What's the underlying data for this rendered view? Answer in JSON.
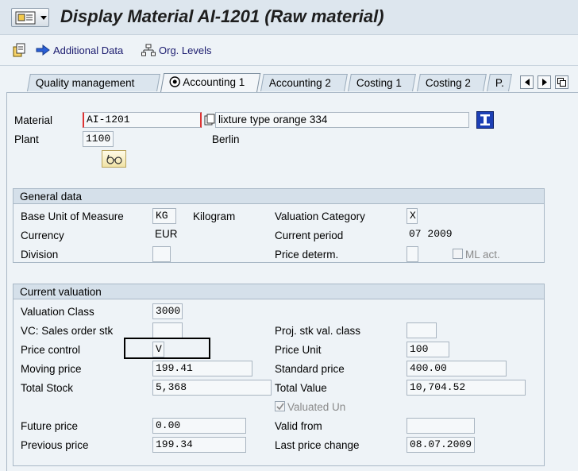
{
  "window": {
    "title": "Display Material AI-1201 (Raw material)"
  },
  "toolbar": {
    "additional_data": "Additional Data",
    "org_levels": "Org. Levels"
  },
  "tabs": [
    {
      "label": "Quality management",
      "active": false
    },
    {
      "label": "Accounting 1",
      "active": true
    },
    {
      "label": "Accounting 2",
      "active": false
    },
    {
      "label": "Costing 1",
      "active": false
    },
    {
      "label": "Costing 2",
      "active": false
    },
    {
      "label": "P.",
      "active": false
    }
  ],
  "header": {
    "material_label": "Material",
    "material_value": "AI-1201",
    "material_desc": "lixture type orange 334",
    "plant_label": "Plant",
    "plant_value": "1100",
    "plant_name": "Berlin"
  },
  "general": {
    "title": "General data",
    "base_uom_label": "Base Unit of Measure",
    "base_uom_value": "KG",
    "base_uom_text": "Kilogram",
    "valuation_category_label": "Valuation Category",
    "valuation_category_value": "X",
    "currency_label": "Currency",
    "currency_value": "EUR",
    "current_period_label": "Current period",
    "current_period_value": "07 2009",
    "division_label": "Division",
    "division_value": "",
    "price_determ_label": "Price determ.",
    "price_determ_value": "",
    "ml_act_label": "ML act.",
    "ml_act_checked": false
  },
  "valuation": {
    "title": "Current valuation",
    "valuation_class_label": "Valuation Class",
    "valuation_class_value": "3000",
    "vc_sales_label": "VC: Sales order stk",
    "vc_sales_value": "",
    "proj_stk_label": "Proj. stk val. class",
    "proj_stk_value": "",
    "price_control_label": "Price control",
    "price_control_value": "V",
    "price_unit_label": "Price Unit",
    "price_unit_value": "100",
    "moving_price_label": "Moving price",
    "moving_price_value": "199.41",
    "standard_price_label": "Standard price",
    "standard_price_value": "400.00",
    "total_stock_label": "Total Stock",
    "total_stock_value": "5,368",
    "total_value_label": "Total Value",
    "total_value_value": "10,704.52",
    "valuated_un_label": "Valuated Un",
    "valuated_un_checked": true,
    "future_price_label": "Future price",
    "future_price_value": "0.00",
    "valid_from_label": "Valid from",
    "valid_from_value": "",
    "previous_price_label": "Previous price",
    "previous_price_value": "199.34",
    "last_price_change_label": "Last price change",
    "last_price_change_value": "08.07.2009"
  },
  "icons": {
    "menu": "menu-icon",
    "other_material": "other-material-icon",
    "additional_data": "arrow-right-icon",
    "org_levels": "hierarchy-icon",
    "info": "info-icon",
    "glasses": "glasses-icon"
  }
}
